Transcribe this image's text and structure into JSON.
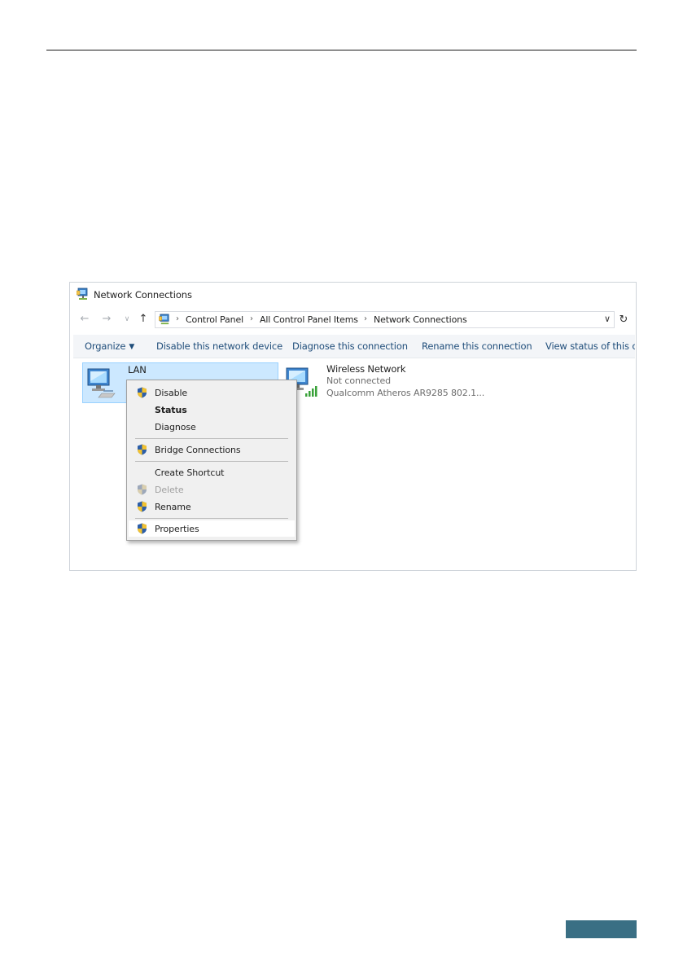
{
  "window": {
    "title": "Network Connections",
    "title_icon": "network-connections-icon"
  },
  "navigation": {
    "back_icon": "back-arrow-icon",
    "forward_icon": "forward-arrow-icon",
    "recent_icon": "chevron-down-icon",
    "up_icon": "up-arrow-icon",
    "breadcrumbs": [
      "Control Panel",
      "All Control Panel Items",
      "Network Connections"
    ],
    "address_dropdown_icon": "chevron-down-icon",
    "refresh_icon": "refresh-icon"
  },
  "toolbar": {
    "organize": "Organize",
    "disable_device": "Disable this network device",
    "diagnose": "Diagnose this connection",
    "rename": "Rename this connection",
    "view_status": "View status of this connection"
  },
  "connections": [
    {
      "name": "LAN",
      "status": "",
      "device": "",
      "icon": "ethernet-adapter-icon",
      "selected": true
    },
    {
      "name": "Wireless Network",
      "status": "Not connected",
      "device": "Qualcomm Atheros AR9285 802.1...",
      "icon": "wireless-adapter-icon",
      "selected": false
    }
  ],
  "context_menu": {
    "items": [
      {
        "label": "Disable",
        "shield": true,
        "bold": false,
        "disabled": false
      },
      {
        "label": "Status",
        "shield": false,
        "bold": true,
        "disabled": false
      },
      {
        "label": "Diagnose",
        "shield": false,
        "bold": false,
        "disabled": false
      },
      {
        "label": "Bridge Connections",
        "shield": true,
        "bold": false,
        "disabled": false
      },
      {
        "label": "Create Shortcut",
        "shield": false,
        "bold": false,
        "disabled": false
      },
      {
        "label": "Delete",
        "shield": true,
        "bold": false,
        "disabled": true
      },
      {
        "label": "Rename",
        "shield": true,
        "bold": false,
        "disabled": false
      },
      {
        "label": "Properties",
        "shield": true,
        "bold": false,
        "disabled": false,
        "hovered": true
      }
    ]
  },
  "colors": {
    "selection_fill": "#cce8ff",
    "selection_border": "#99d1ff",
    "toolbar_text": "#1f4d7a",
    "footer_tab": "#3a6f84"
  }
}
